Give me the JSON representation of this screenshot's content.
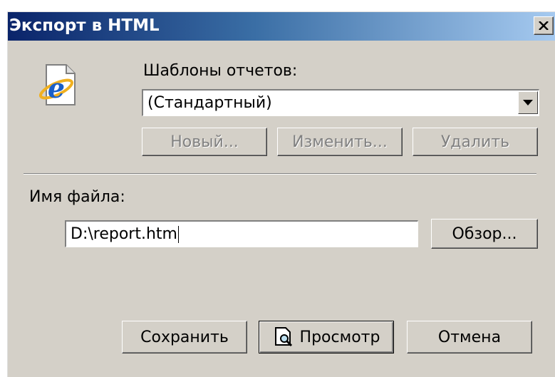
{
  "window": {
    "title": "Экспорт в HTML"
  },
  "templates": {
    "label": "Шаблоны отчетов:",
    "selected": "(Стандартный)",
    "buttons": {
      "new": "Новый...",
      "edit": "Изменить...",
      "delete": "Удалить"
    }
  },
  "file": {
    "label": "Имя файла:",
    "value": "D:\\report.htm",
    "browse": "Обзор..."
  },
  "footer": {
    "save": "Сохранить",
    "preview": "Просмотр",
    "cancel": "Отмена"
  },
  "icons": {
    "app": "ie-document-icon",
    "close": "close-icon",
    "dropdown": "chevron-down-icon",
    "preview": "magnifier-document-icon"
  },
  "colors": {
    "titlebar_start": "#0a246a",
    "titlebar_end": "#a6caf0",
    "face": "#d4d0c8"
  }
}
